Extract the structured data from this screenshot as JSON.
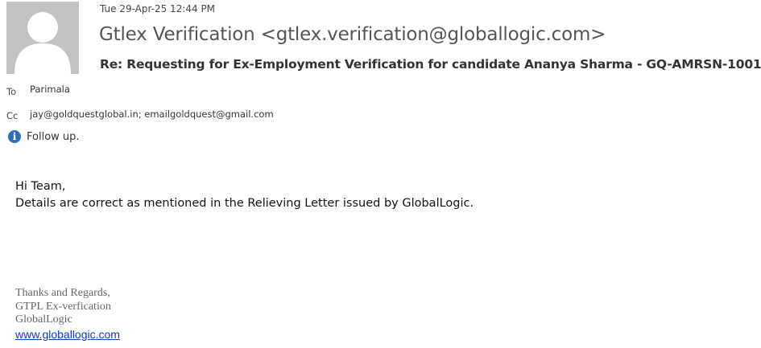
{
  "message": {
    "timestamp": "Tue 29-Apr-25 12:44 PM",
    "sender": "Gtlex Verification <gtlex.verification@globallogic.com>",
    "subject": "Re: Requesting for Ex-Employment Verification for candidate Ananya Sharma - GQ-AMRSN-1001"
  },
  "recipients": {
    "to_label": "To",
    "to_value": "Parimala",
    "cc_label": "Cc",
    "cc_value": "jay@goldquestglobal.in; emailgoldquest@gmail.com"
  },
  "info_bar": {
    "icon": "info-icon",
    "text": "Follow up."
  },
  "body": {
    "greeting": "Hi Team,",
    "line1": "Details are correct as mentioned in the Relieving Letter issued by GlobalLogic."
  },
  "signature": {
    "line1": "Thanks and Regards,",
    "line2": "GTPL Ex-verfication",
    "line3": "GlobalLogic",
    "link": "www.globallogic.com"
  },
  "colors": {
    "avatar_bg": "#c3c3c3",
    "info_icon": "#2f6fb5",
    "link": "#0645ad"
  }
}
